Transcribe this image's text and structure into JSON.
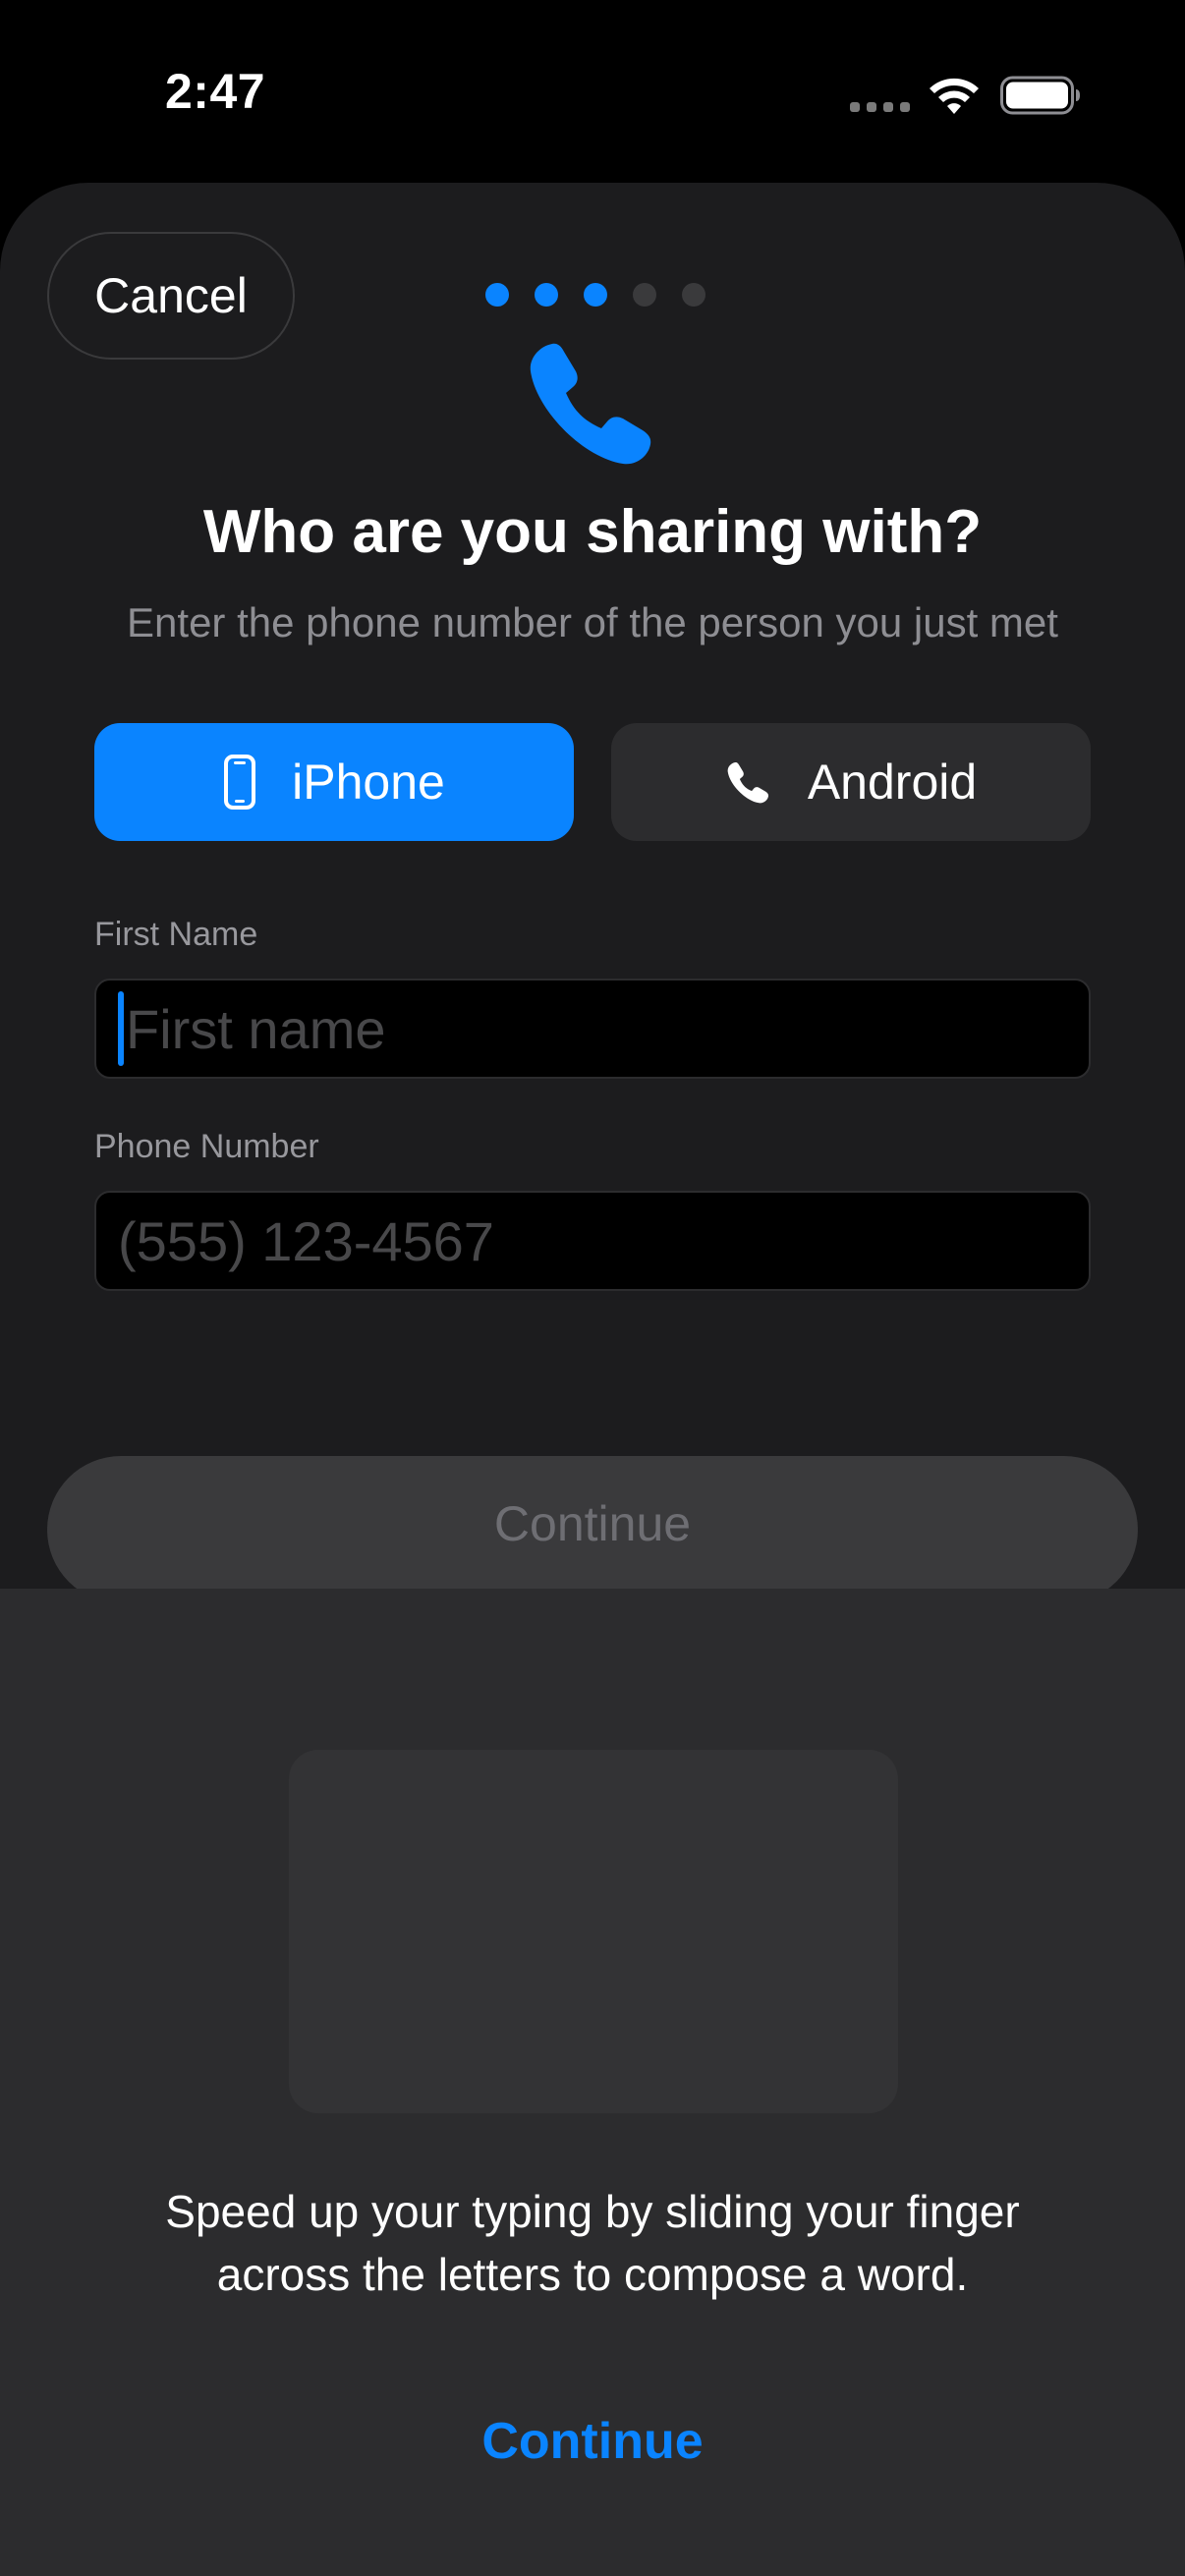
{
  "status_bar": {
    "time": "2:47"
  },
  "header": {
    "cancel_label": "Cancel",
    "steps_total": 5,
    "steps_completed": 3
  },
  "hero": {
    "icon": "phone-icon",
    "title": "Who are you sharing with?",
    "subtitle": "Enter the phone number of the person you just met"
  },
  "device_toggle": {
    "selected": "iPhone",
    "options": [
      {
        "label": "iPhone",
        "icon": "iphone-icon"
      },
      {
        "label": "Android",
        "icon": "phone-icon"
      }
    ]
  },
  "form": {
    "first_name": {
      "label": "First Name",
      "placeholder": "First name",
      "value": ""
    },
    "phone": {
      "label": "Phone Number",
      "placeholder": "(555) 123-4567",
      "value": ""
    }
  },
  "primary_action": {
    "label": "Continue",
    "enabled": false
  },
  "keyboard_tip": {
    "line1": "Speed up your typing by sliding your finger",
    "line2": "across the letters to compose a word.",
    "continue_label": "Continue"
  },
  "colors": {
    "accent": "#0a84ff",
    "sheet_bg": "#1c1c1e",
    "panel_bg": "#2c2c2e"
  }
}
